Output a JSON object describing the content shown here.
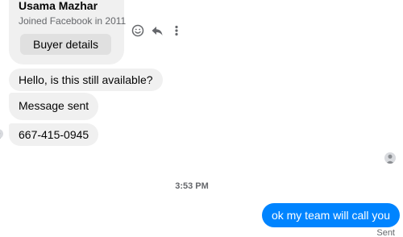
{
  "buyer_card": {
    "name": "Usama Mazhar",
    "joined": "Joined Facebook in 2011",
    "button_label": "Buyer details"
  },
  "actions": {
    "icons": [
      "emoji-icon",
      "reply-icon",
      "more-options-icon"
    ]
  },
  "messages_in": [
    {
      "text": "Hello, is this still available?"
    },
    {
      "text": "Message sent"
    },
    {
      "text": "667-415-0945"
    }
  ],
  "timestamp": "3:53 PM",
  "message_out": {
    "text": "ok my team will call you",
    "status": "Sent"
  },
  "colors": {
    "bubble_in": "#f0f0f0",
    "bubble_out": "#0084ff",
    "secondary_text": "#65676b"
  }
}
